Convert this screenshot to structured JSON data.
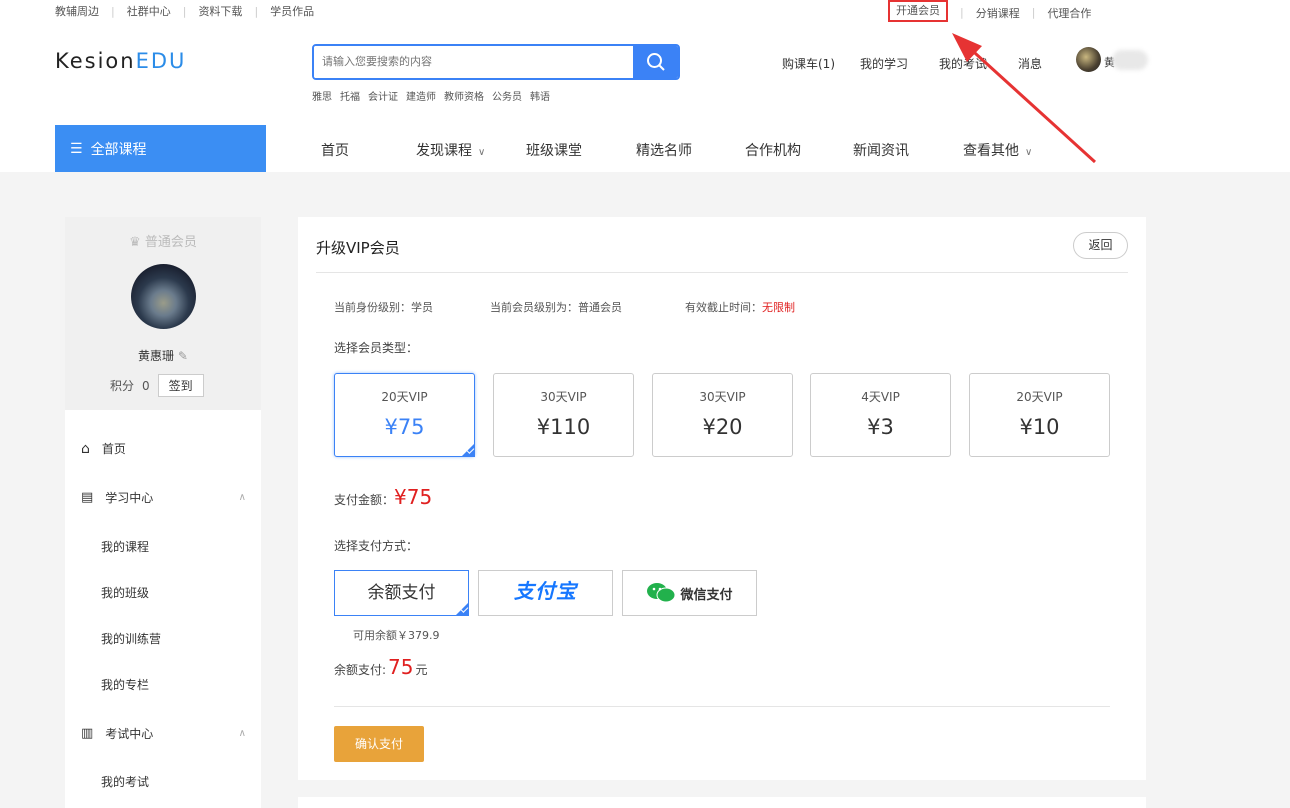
{
  "topbar": {
    "left_links": [
      "教辅周边",
      "社群中心",
      "资料下载",
      "学员作品"
    ],
    "right_links": [
      "开通会员",
      "分销课程",
      "代理合作"
    ]
  },
  "header": {
    "logo_main": "Kesion",
    "logo_accent": "EDU",
    "search_placeholder": "请输入您要搜索的内容",
    "hot_words": [
      "雅思",
      "托福",
      "会计证",
      "建造师",
      "教师资格",
      "公务员",
      "韩语"
    ],
    "cart": "购课车(1)",
    "my_study": "我的学习",
    "my_exam": "我的考试",
    "messages": "消息",
    "user_short": "黄"
  },
  "nav": {
    "all_courses": "全部课程",
    "items": [
      "首页",
      "发现课程",
      "班级课堂",
      "精选名师",
      "合作机构",
      "新闻资讯",
      "查看其他"
    ]
  },
  "sidebar": {
    "member_badge": "普通会员",
    "username": "黄惠珊",
    "points_label": "积分",
    "points_value": "0",
    "sign_in": "签到",
    "home": "首页",
    "study_center": "学习中心",
    "study_items": [
      "我的课程",
      "我的班级",
      "我的训练营",
      "我的专栏"
    ],
    "exam_center": "考试中心",
    "exam_items": [
      "我的考试"
    ]
  },
  "main": {
    "title": "升级VIP会员",
    "back": "返回",
    "identity": "当前身份级别：学员",
    "member_level": "当前会员级别为：普通会员",
    "expiry_label": "有效截止时间：",
    "expiry_value": "无限制",
    "choose_type": "选择会员类型：",
    "vip_options": [
      {
        "name": "20天VIP",
        "price": "¥75"
      },
      {
        "name": "30天VIP",
        "price": "¥110"
      },
      {
        "name": "30天VIP",
        "price": "¥20"
      },
      {
        "name": "4天VIP",
        "price": "¥3"
      },
      {
        "name": "20天VIP",
        "price": "¥10"
      }
    ],
    "pay_amount_label": "支付金额：",
    "pay_amount": "¥75",
    "choose_pay": "选择支付方式：",
    "pay_balance": "余额支付",
    "pay_alipay": "支付宝",
    "pay_wechat": "微信支付",
    "available_balance": "可用余额￥379.9",
    "balance_pay_label": "余额支付:",
    "balance_pay_value": "75",
    "balance_pay_unit": "元",
    "confirm": "确认支付"
  },
  "colors": {
    "accent": "#3b82f6",
    "price_red": "#e02020",
    "confirm": "#e8a33a",
    "annotation": "#e63333"
  }
}
